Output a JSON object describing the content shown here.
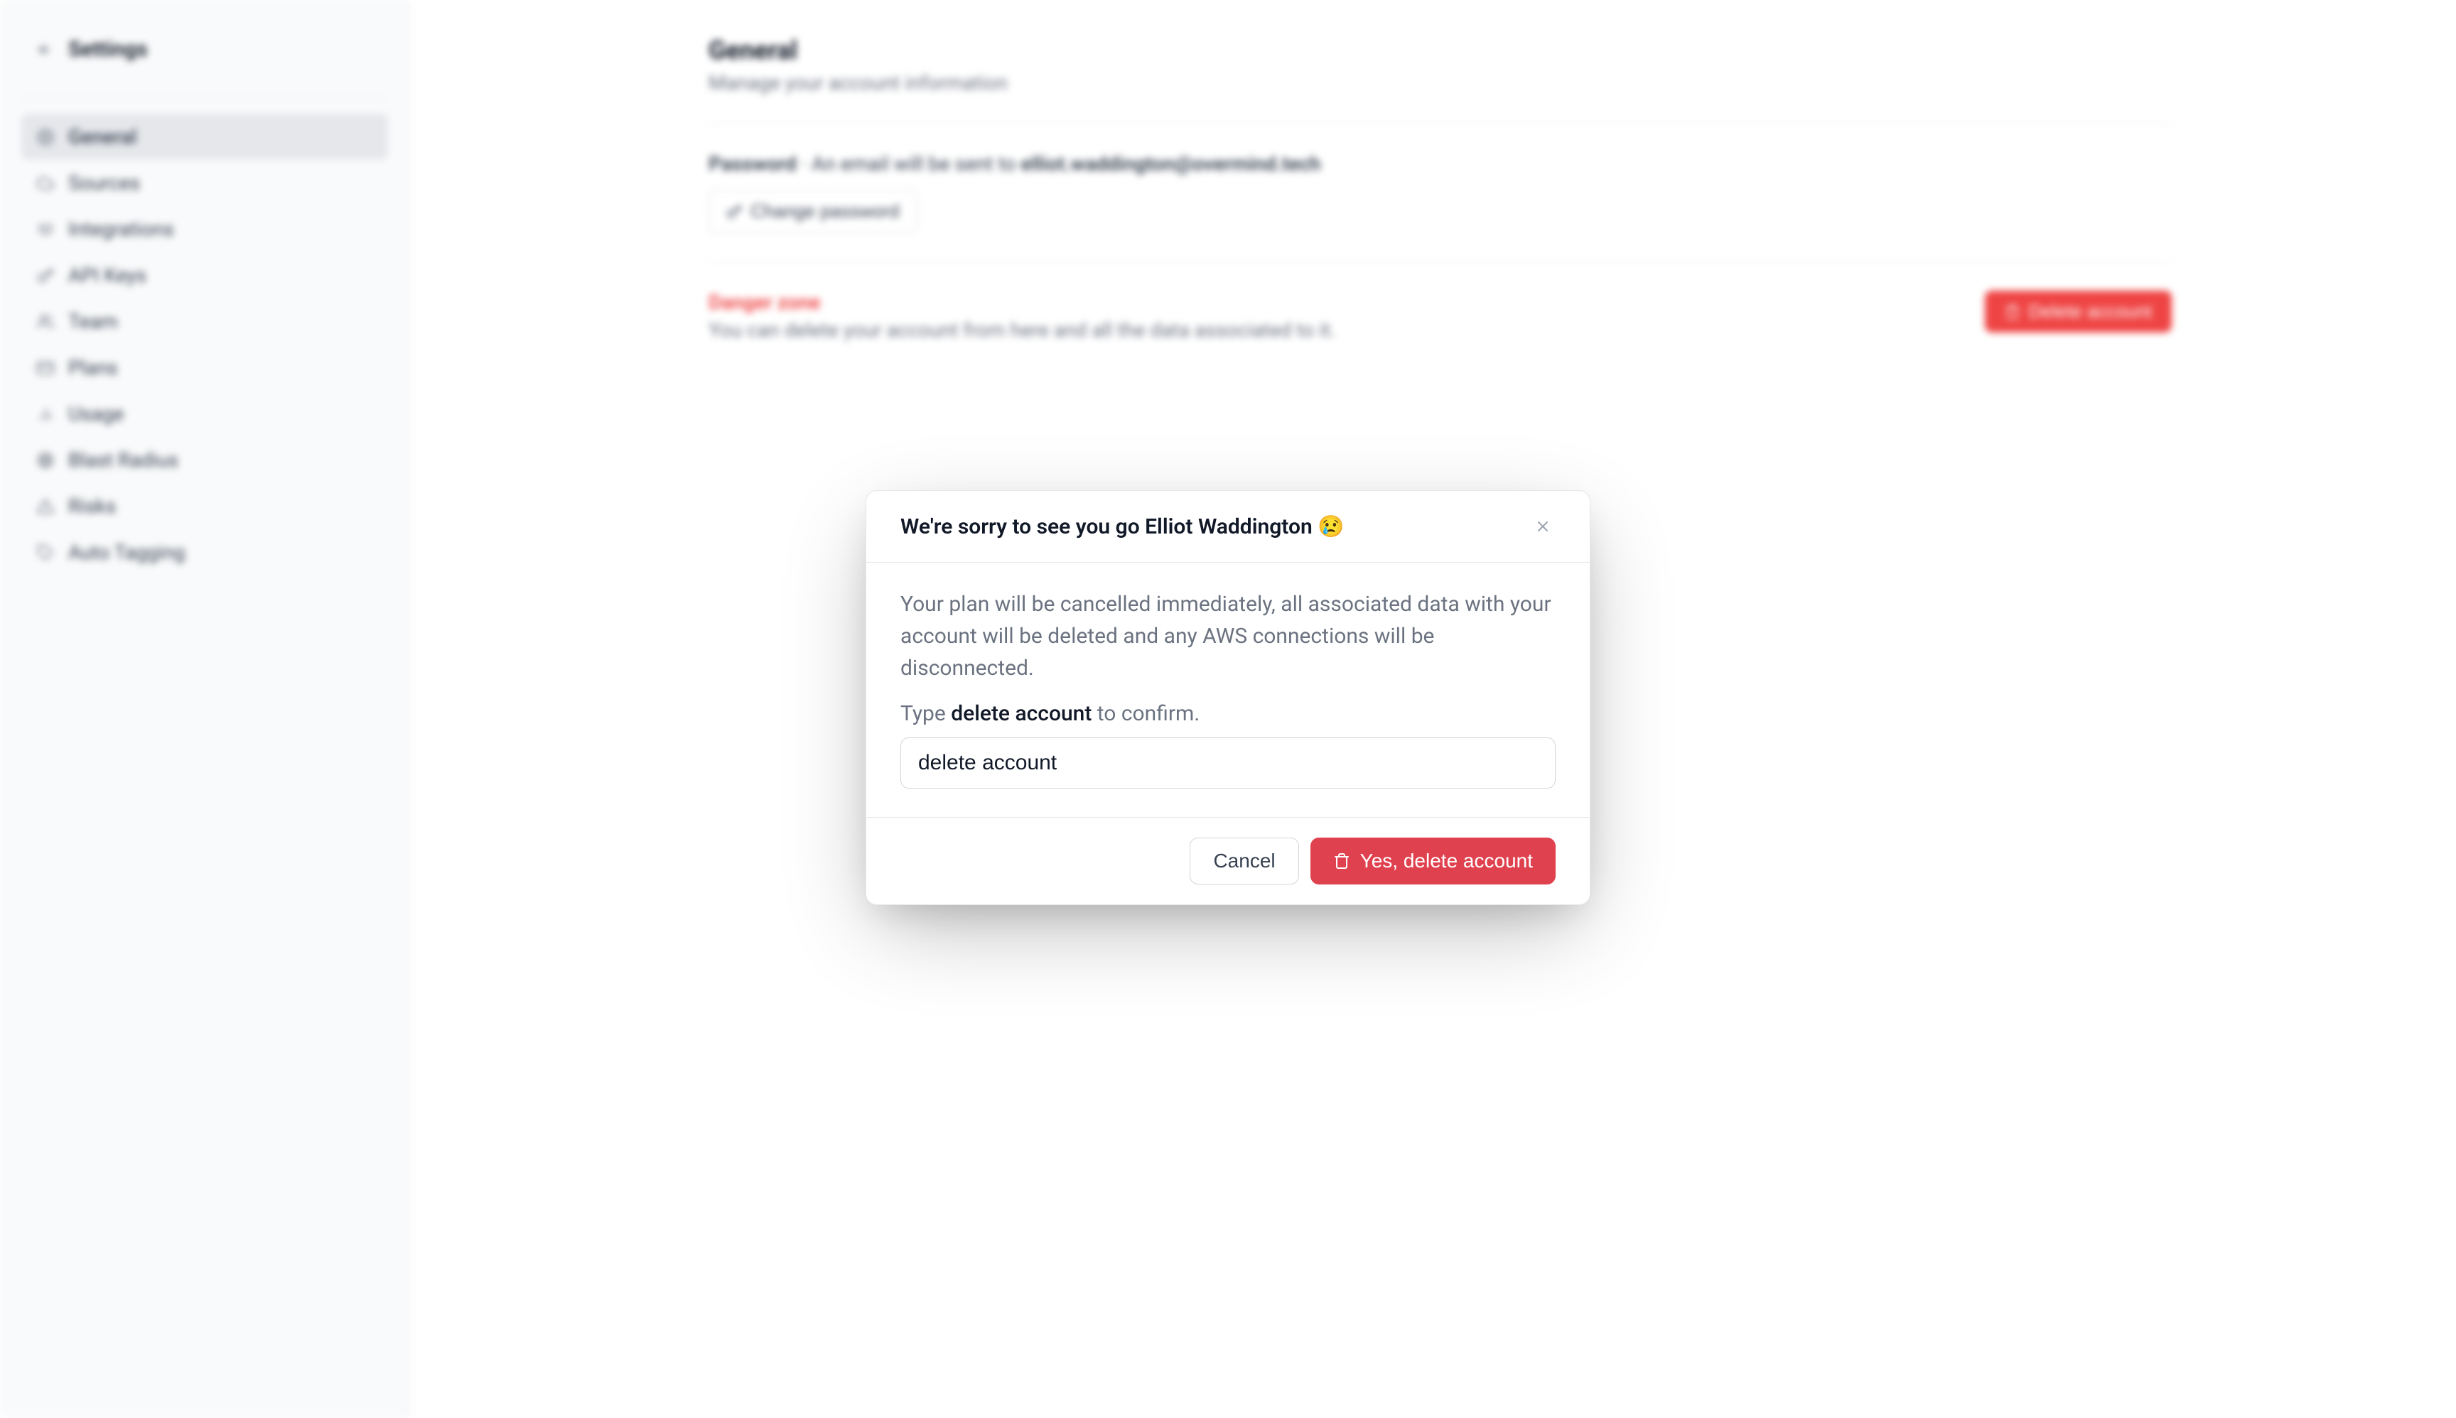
{
  "sidebar": {
    "title": "Settings",
    "items": [
      {
        "label": "General",
        "icon": "gear-icon",
        "active": true
      },
      {
        "label": "Sources",
        "icon": "cloud-icon",
        "active": false
      },
      {
        "label": "Integrations",
        "icon": "plug-icon",
        "active": false
      },
      {
        "label": "API Keys",
        "icon": "key-icon",
        "active": false
      },
      {
        "label": "Team",
        "icon": "users-icon",
        "active": false
      },
      {
        "label": "Plans",
        "icon": "card-icon",
        "active": false
      },
      {
        "label": "Usage",
        "icon": "chart-icon",
        "active": false
      },
      {
        "label": "Blast Radius",
        "icon": "radar-icon",
        "active": false
      },
      {
        "label": "Risks",
        "icon": "warning-icon",
        "active": false
      },
      {
        "label": "Auto Tagging",
        "icon": "tag-icon",
        "active": false
      }
    ]
  },
  "main": {
    "title": "General",
    "subtitle": "Manage your account information",
    "password": {
      "label": "Password",
      "desc_prefix": " · An email will be sent to ",
      "email": "elliot.waddington@overmind.tech",
      "change_label": "Change password"
    },
    "danger": {
      "title": "Danger zone",
      "desc": "You can delete your account from here and all the data associated to it.",
      "delete_label": "Delete account"
    }
  },
  "modal": {
    "title": "We're sorry to see you go Elliot Waddington 😢",
    "body_text": "Your plan will be cancelled immediately, all associated data with your account will be deleted and any AWS connections will be disconnected.",
    "confirm_prefix": "Type ",
    "confirm_phrase": "delete account",
    "confirm_suffix": " to confirm.",
    "input_value": "delete account",
    "cancel_label": "Cancel",
    "confirm_label": "Yes, delete account"
  },
  "colors": {
    "danger": "#e0414e",
    "text_muted": "#6b7280",
    "border": "#e5e7eb"
  }
}
